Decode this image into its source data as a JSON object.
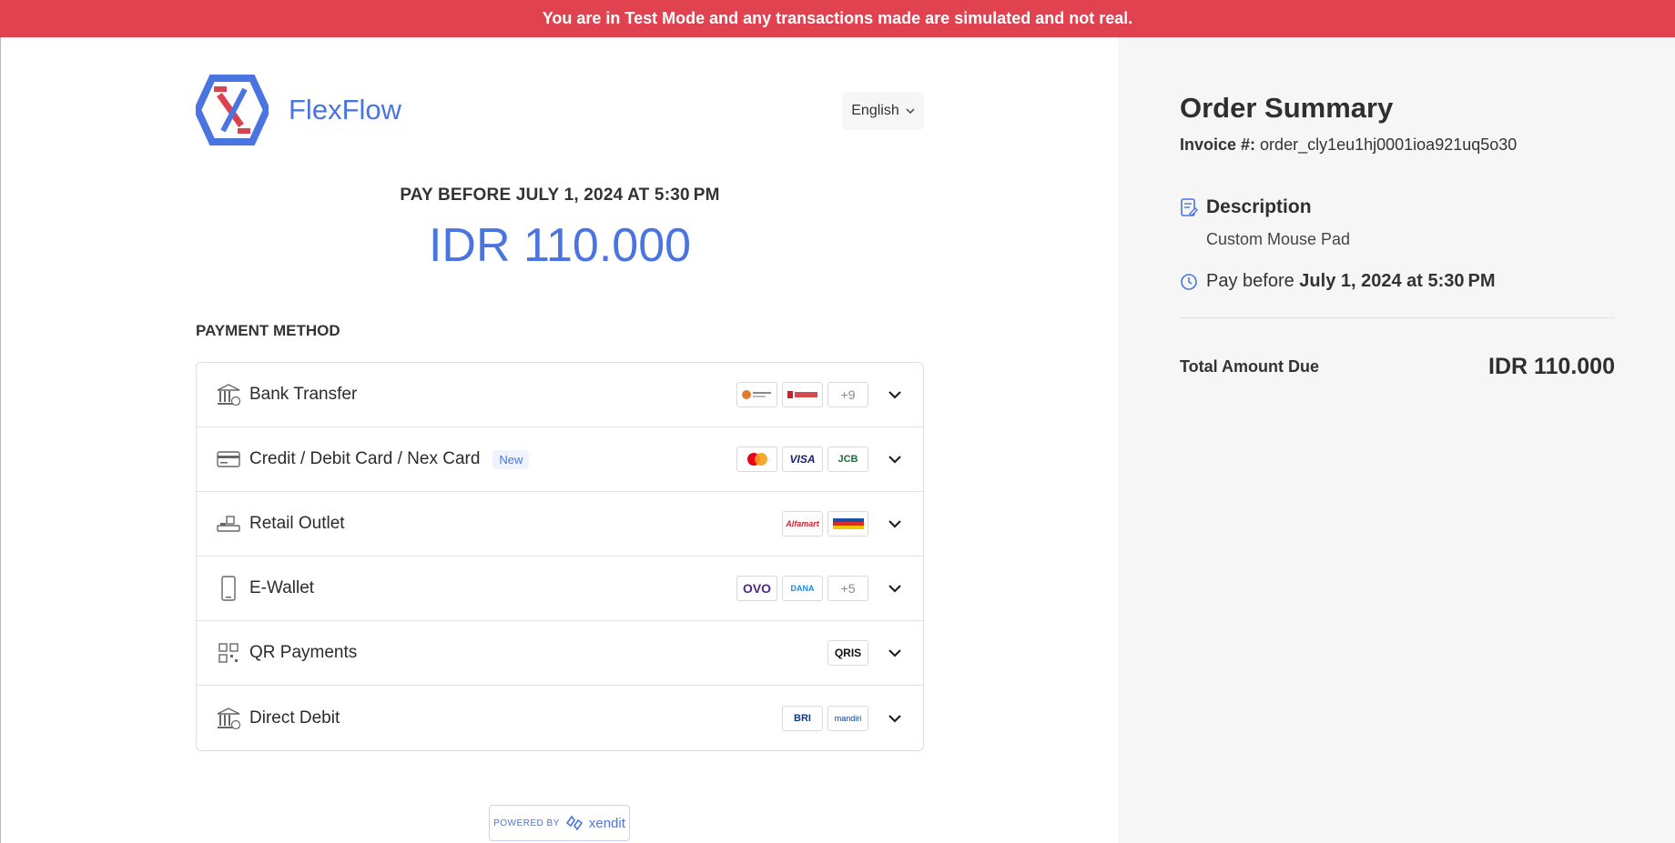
{
  "banner": {
    "text": "You are in Test Mode and any transactions made are simulated and not real."
  },
  "brand": {
    "name": "FlexFlow",
    "logo_icon": "flexflow-hexagon-logo",
    "colors": {
      "primary": "#4a74e0",
      "accent": "#d9424f"
    }
  },
  "language": {
    "selected": "English",
    "icon": "chevron-down-icon"
  },
  "payment": {
    "pay_before": "PAY BEFORE JULY 1, 2024 AT 5:30 PM",
    "amount": "IDR 110.000"
  },
  "payment_method": {
    "title": "PAYMENT METHOD",
    "methods": [
      {
        "label": "Bank Transfer",
        "icon": "bank-icon",
        "logos": [
          "bank-logo-1",
          "cimb-niaga-logo"
        ],
        "more": "+9"
      },
      {
        "label": "Credit / Debit Card / Nex Card",
        "icon": "credit-card-icon",
        "badge": "New",
        "logos": [
          "mastercard-logo",
          "VISA",
          "JCB"
        ]
      },
      {
        "label": "Retail Outlet",
        "icon": "cashier-icon",
        "logos": [
          "Alfamart",
          "indomaret-logo"
        ]
      },
      {
        "label": "E-Wallet",
        "icon": "phone-icon",
        "logos": [
          "OVO",
          "DANA"
        ],
        "more": "+5"
      },
      {
        "label": "QR Payments",
        "icon": "qr-icon",
        "logos": [
          "QRIS"
        ]
      },
      {
        "label": "Direct Debit",
        "icon": "bank-icon",
        "logos": [
          "BRI",
          "mandiri"
        ]
      }
    ]
  },
  "powered_by": {
    "prefix": "POWERED BY",
    "name": "xendit"
  },
  "order_summary": {
    "title": "Order Summary",
    "invoice_label": "Invoice #:",
    "invoice_value": "order_cly1eu1hj0001ioa921uq5o30",
    "description_title": "Description",
    "description_value": "Custom Mouse Pad",
    "pay_before_prefix": "Pay before",
    "pay_before_value": "July 1, 2024 at 5:30 PM",
    "total_label": "Total Amount Due",
    "total_value": "IDR 110.000"
  }
}
